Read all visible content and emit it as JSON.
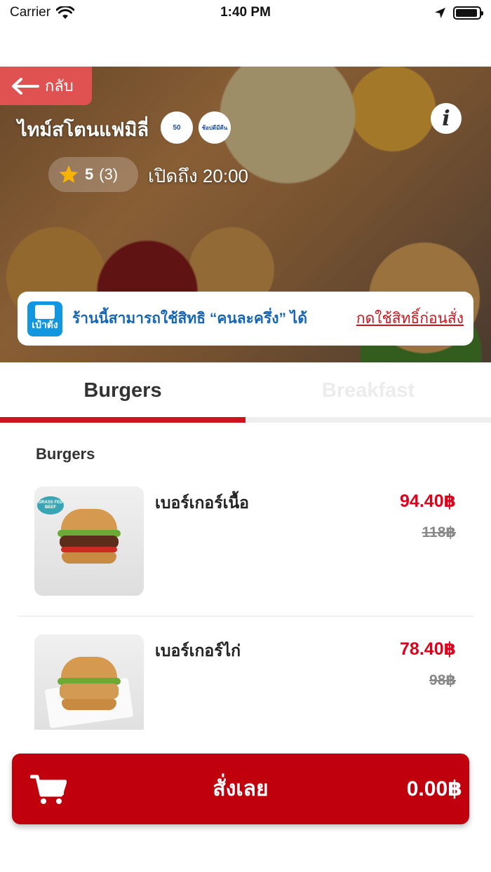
{
  "status_bar": {
    "carrier": "Carrier",
    "time": "1:40 PM",
    "battery_level": 0.95,
    "icons": [
      "wifi-icon",
      "location-icon",
      "battery-icon"
    ]
  },
  "header": {
    "back_label": "กลับ",
    "shop_name": "ไทม์สโตนแฟมิลี่",
    "badges": [
      {
        "name": "half-half-badge",
        "text": "50"
      },
      {
        "name": "shop-badge",
        "text": "ช้อปดีมีคืน"
      }
    ],
    "rating_score": "5",
    "rating_count": "(3)",
    "open_time": "เปิดถึง 20:00",
    "info_icon": "i"
  },
  "promo": {
    "logo_text": "เป๋าตัง",
    "text": "ร้านนี้สามารถใช้สิทธิ “คนละครึ่ง” ได้",
    "link": "กดใช้สิทธิ์ก่อนสั่ง"
  },
  "tabs": [
    {
      "label": "Burgers",
      "active": true
    },
    {
      "label": "Breakfast",
      "active": false
    }
  ],
  "menu": {
    "section_title": "Burgers",
    "items": [
      {
        "name": "เบอร์เกอร์เนื้อ",
        "price": "94.40฿",
        "original_price": "118฿",
        "image_badge": "GRASS FED BEEF"
      },
      {
        "name": "เบอร์เกอร์ไก่",
        "price": "78.40฿",
        "original_price": "98฿"
      }
    ]
  },
  "order_bar": {
    "label": "สั่งเลย",
    "total": "0.00฿"
  },
  "colors": {
    "brand_red": "#c0000d",
    "price_red": "#e0001b",
    "back_button": "#e05252",
    "promo_blue": "#1566b4"
  }
}
